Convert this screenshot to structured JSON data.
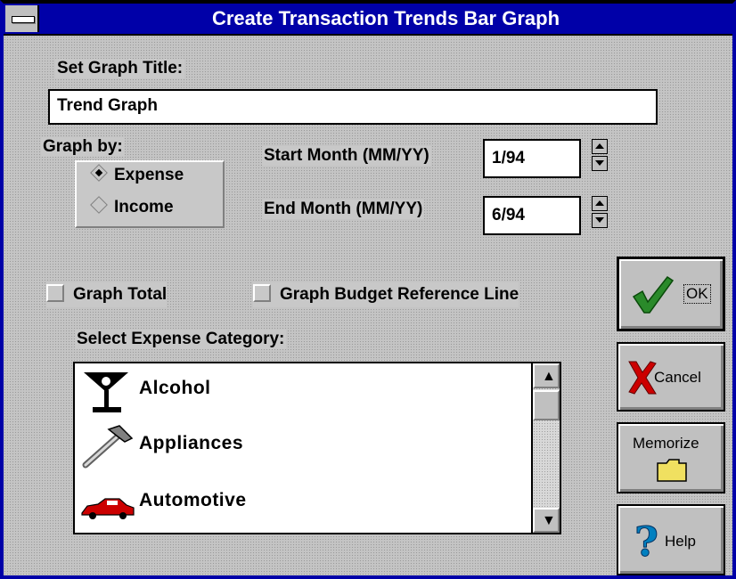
{
  "window": {
    "title": "Create Transaction Trends Bar Graph"
  },
  "graph_title": {
    "label": "Set Graph Title:",
    "value": "Trend Graph"
  },
  "graph_by": {
    "label": "Graph by:",
    "options": [
      {
        "label": "Expense",
        "selected": true
      },
      {
        "label": "Income",
        "selected": false
      }
    ]
  },
  "start_month": {
    "label": "Start Month (MM/YY)",
    "value": "1/94"
  },
  "end_month": {
    "label": "End Month (MM/YY)",
    "value": "6/94"
  },
  "checkboxes": {
    "total": {
      "label": "Graph Total",
      "checked": false
    },
    "budget": {
      "label": "Graph Budget Reference Line",
      "checked": false
    }
  },
  "category": {
    "label": "Select Expense Category:",
    "items": [
      {
        "label": "Alcohol",
        "icon": "martini-glass-icon"
      },
      {
        "label": "Appliances",
        "icon": "hammer-icon"
      },
      {
        "label": "Automotive",
        "icon": "car-icon"
      }
    ]
  },
  "buttons": {
    "ok": "OK",
    "cancel": "Cancel",
    "memorize": "Memorize",
    "help": "Help"
  },
  "colors": {
    "titlebar": "#0000a8",
    "face": "#c0c0c0",
    "ok_check": "#2a8a2a",
    "cancel_x": "#cc0000",
    "help_q": "#0080c0"
  }
}
